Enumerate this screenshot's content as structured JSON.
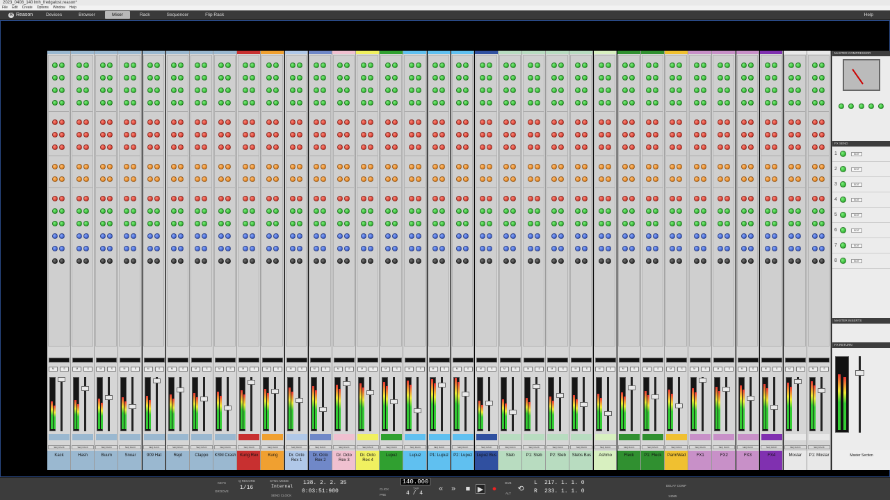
{
  "window": {
    "title": "2023_0408_140 lmh_fredgalost.reason*"
  },
  "menu": [
    "File",
    "Edit",
    "Create",
    "Options",
    "Window",
    "Help"
  ],
  "nav": {
    "logo": "Reason",
    "tabs": [
      "Devices",
      "Browser",
      "Mixer",
      "Rack",
      "Sequencer",
      "Flip Rack"
    ],
    "active_tab": "Mixer",
    "help": "Help"
  },
  "channels": [
    {
      "name": "Kack",
      "color": "#9ab8d0"
    },
    {
      "name": "Hash",
      "color": "#9ab8d0"
    },
    {
      "name": "Buum",
      "color": "#9ab8d0"
    },
    {
      "name": "Snoar",
      "color": "#9ab8d0"
    },
    {
      "name": "909 Hat",
      "color": "#9ab8d0"
    },
    {
      "name": "Rejd",
      "color": "#9ab8d0"
    },
    {
      "name": "Clappo",
      "color": "#9ab8d0"
    },
    {
      "name": "KSM Crash",
      "color": "#9ab8d0"
    },
    {
      "name": "Kung Rex",
      "color": "#c83030"
    },
    {
      "name": "Kung",
      "color": "#f0a030"
    },
    {
      "name": "Dr. Octo Rex 1",
      "color": "#b0c8e8"
    },
    {
      "name": "Dr. Octo Rex 2",
      "color": "#7088c8"
    },
    {
      "name": "Dr. Octo Rex 3",
      "color": "#f0c0d0"
    },
    {
      "name": "Dr. Octo Rex 4",
      "color": "#f0f060"
    },
    {
      "name": "Lupuz",
      "color": "#30a030"
    },
    {
      "name": "Lupuz",
      "color": "#60c0f0"
    },
    {
      "name": "P1: Lupuz",
      "color": "#60c0f0"
    },
    {
      "name": "P2: Lupuz",
      "color": "#60c0f0"
    },
    {
      "name": "Lupuz Bus",
      "color": "#3050a0"
    },
    {
      "name": "Steb",
      "color": "#b8dcc0"
    },
    {
      "name": "P1: Steb",
      "color": "#b8dcc0"
    },
    {
      "name": "P2: Steb",
      "color": "#b8dcc0"
    },
    {
      "name": "Stebs Bus",
      "color": "#b8dcc0"
    },
    {
      "name": "Ashmo",
      "color": "#d8f0c0"
    },
    {
      "name": "Fleck",
      "color": "#309030"
    },
    {
      "name": "P1: Fleck",
      "color": "#309030"
    },
    {
      "name": "ParmWad",
      "color": "#f0c030"
    },
    {
      "name": "FX1",
      "color": "#c890c8"
    },
    {
      "name": "FX2",
      "color": "#c890c8"
    },
    {
      "name": "FX3",
      "color": "#c890c8"
    },
    {
      "name": "FX4",
      "color": "#8030b0"
    },
    {
      "name": "Mostar",
      "color": "#e8e8e8"
    },
    {
      "name": "P1: Mostar",
      "color": "#e8e8e8"
    }
  ],
  "master": {
    "compressor_title": "MASTER COMPRESSOR",
    "fx_send_title": "FX SEND",
    "fx_slots": [
      "1",
      "2",
      "3",
      "4",
      "5",
      "6",
      "7",
      "8"
    ],
    "inserts_title": "MASTER INSERTS",
    "fx_return_title": "FX RETURN",
    "name": "Master Section"
  },
  "transport": {
    "keys": "KEYS",
    "groove": "GROOVE",
    "quantize": "1/16",
    "quantize_label": "Q RECORD",
    "sync_mode_label": "SYNC MODE",
    "sync_mode": "Internal",
    "send_clock": "SEND CLOCK",
    "position_bars": "138. 2. 2. 35",
    "position_time": "0:03:51:980",
    "click_label": "CLICK",
    "pre_label": "PRE",
    "tempo": "140.000",
    "tap": "TAP",
    "signature": "4 / 4",
    "dub": "DUB",
    "alt": "ALT",
    "loop_l": "217. 1. 1. 0",
    "loop_r": "233. 1. 1. 0",
    "l_label": "L",
    "r_label": "R",
    "delay_comp_label": "DELAY COMP",
    "delay_comp_value": "14065"
  }
}
